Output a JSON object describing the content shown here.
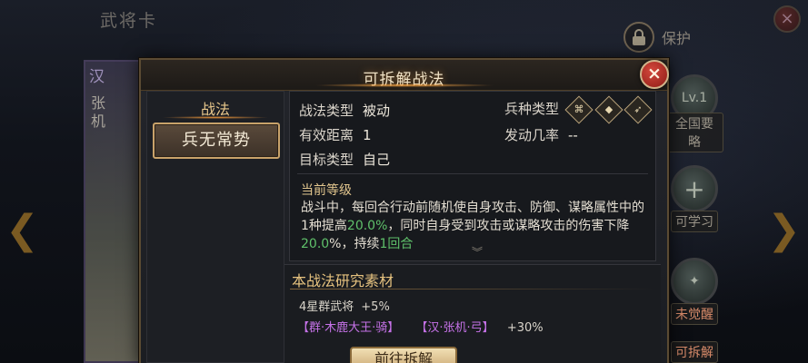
{
  "background": {
    "title": "武将卡",
    "protect_label": "保护",
    "side_buttons": [
      {
        "label": "全国要略",
        "level": "Lv.1"
      },
      {
        "label": "可学习"
      },
      {
        "label": "未觉醒"
      },
      {
        "label": "可拆解"
      }
    ],
    "portrait_name": "张机",
    "portrait_faction": "汉"
  },
  "dialog": {
    "title": "可拆解战法",
    "close_label": "×",
    "left_header": "战法",
    "selected_skill": "兵无常势",
    "info": {
      "type_label": "战法类型",
      "type_value": "被动",
      "distance_label": "有效距离",
      "distance_value": "1",
      "target_label": "目标类型",
      "target_value": "自己",
      "troop_label": "兵种类型",
      "troop_icons": [
        "cavalry-icon",
        "shield-icon",
        "archer-icon"
      ],
      "chance_label": "发动几率",
      "chance_value": "--",
      "level_label": "当前等级",
      "desc_1": "战斗中，每回合行动前随机使自身攻击、防御、谋略属性中的1种提高",
      "desc_pct1": "20.0%",
      "desc_2": "，同时自身受到攻击或谋略攻击的伤害下降",
      "desc_pct2": "20.0",
      "desc_3": "%，持续",
      "desc_turns": "1回合"
    },
    "material": {
      "title": "本战法研究素材",
      "line1_name": "4星群武将",
      "line1_bonus": "+5%",
      "line2_a": "【群·木鹿大王·骑】",
      "line2_b": "【汉·张机·弓】",
      "line2_bonus": "+30%"
    },
    "go_button": "前往拆解"
  },
  "colors": {
    "accent_gold": "#e6c27f",
    "highlight_green": "#5fc06a",
    "purple": "#c672e8",
    "close_red": "#c0392b"
  }
}
